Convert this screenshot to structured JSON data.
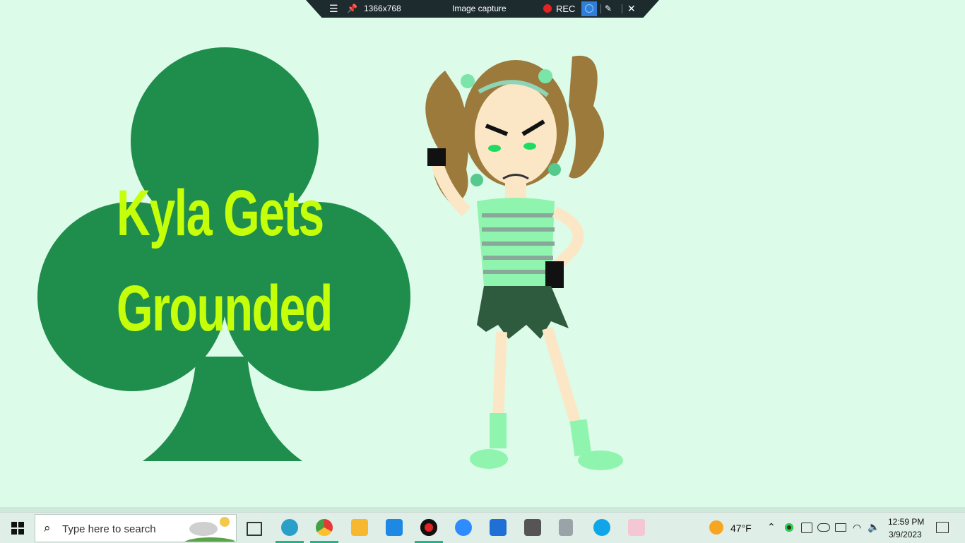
{
  "capture_toolbar": {
    "menu_icon": "hamburger-icon",
    "pin_icon": "pin-icon",
    "resolution": "1366x768",
    "mode": "Image capture",
    "rec_label": "REC",
    "record_color": "#e02424"
  },
  "artwork": {
    "title_line1": "Kyla Gets",
    "title_line2": "Grounded",
    "club_color": "#1f8e4c",
    "title_color": "#c6ff0a",
    "background": "#dcfbe9"
  },
  "taskbar": {
    "search_placeholder": "Type here to search",
    "apps": [
      "task-view",
      "edge",
      "chrome",
      "file-explorer",
      "mail",
      "recorder",
      "zoom",
      "microsoft-store",
      "app-b",
      "voice-recorder",
      "skype",
      "anime-app"
    ],
    "weather_temp": "47°F",
    "time": "12:59 PM",
    "date": "3/9/2023"
  }
}
